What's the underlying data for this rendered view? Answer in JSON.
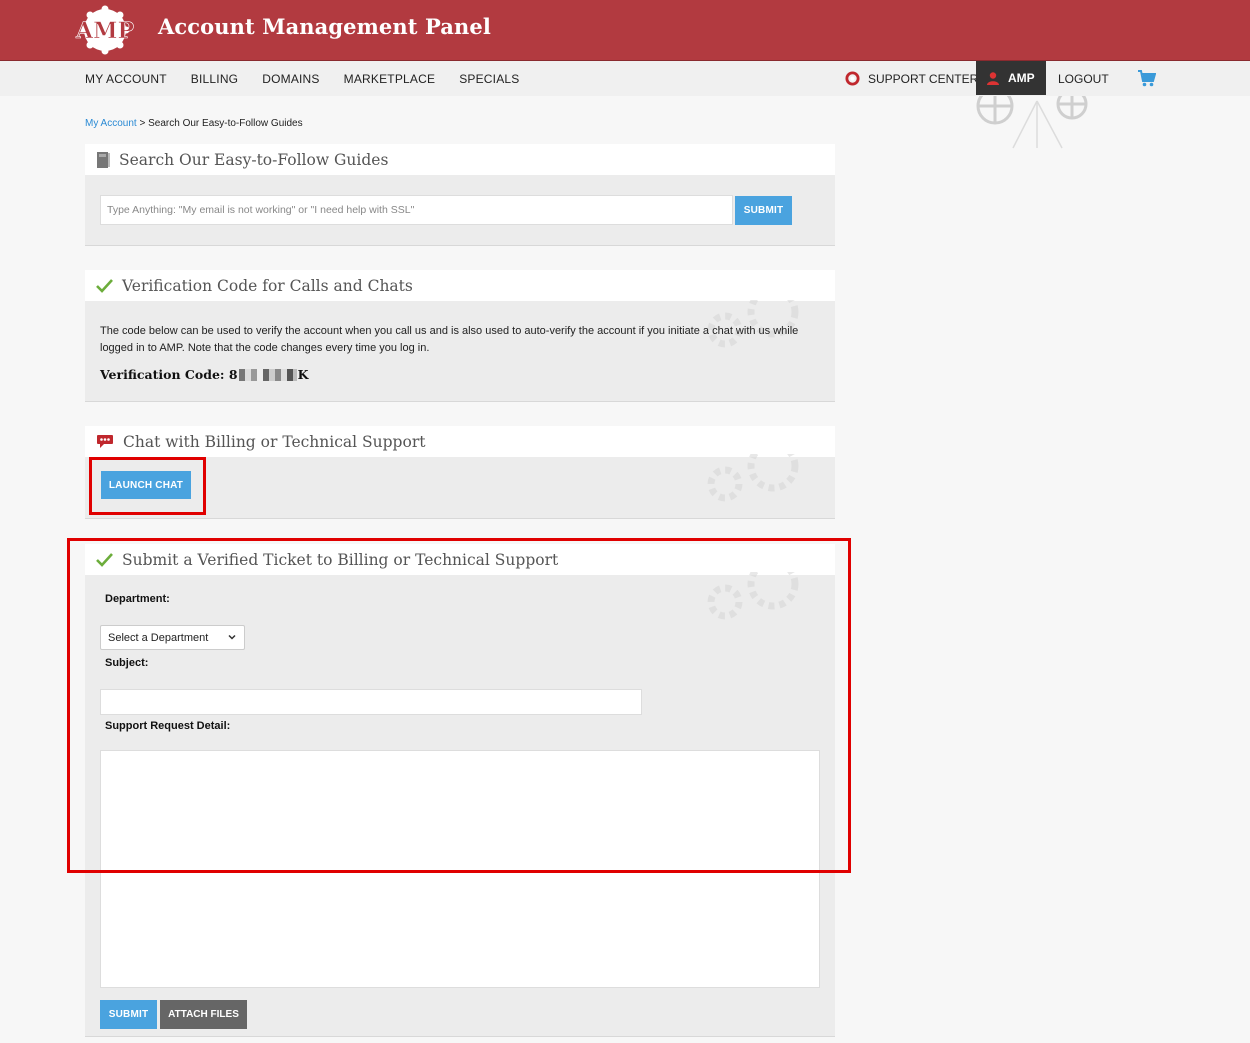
{
  "header": {
    "logo_text": "AMP",
    "title": "Account Management Panel"
  },
  "nav": {
    "items": [
      "MY ACCOUNT",
      "BILLING",
      "DOMAINS",
      "MARKETPLACE",
      "SPECIALS"
    ],
    "support_center": "SUPPORT CENTER",
    "user": "AMP",
    "logout": "LOGOUT"
  },
  "breadcrumb": {
    "link": "My Account",
    "separator": " > ",
    "current": "Search Our Easy-to-Follow Guides"
  },
  "search_panel": {
    "title": "Search Our Easy-to-Follow Guides",
    "placeholder": "Type Anything: \"My email is not working\" or \"I need help with SSL\"",
    "submit_label": "SUBMIT"
  },
  "verification_panel": {
    "title": "Verification Code for Calls and Chats",
    "description": "The code below can be used to verify the account when you call us and is also used to auto-verify the account if you initiate a chat with us while logged in to AMP. Note that the code changes every time you log in.",
    "code_label": "Verification Code:",
    "code_prefix": "8",
    "code_suffix": "K"
  },
  "chat_panel": {
    "title": "Chat with Billing or Technical Support",
    "launch_label": "LAUNCH CHAT"
  },
  "ticket_panel": {
    "title": "Submit a Verified Ticket to Billing or Technical Support",
    "department_label": "Department:",
    "department_selected": "Select a Department",
    "subject_label": "Subject:",
    "subject_value": "",
    "detail_label": "Support Request Detail:",
    "detail_value": "",
    "submit_label": "SUBMIT",
    "attach_label": "ATTACH FILES"
  },
  "colors": {
    "header_red": "#b23a40",
    "button_blue": "#4aa3df",
    "link_blue": "#2a8ad4",
    "check_green": "#6cad3b",
    "highlight_red": "#e00000"
  },
  "icons": [
    "amp-logo",
    "lifebuoy-icon",
    "user-icon",
    "cart-icon",
    "book-icon",
    "check-icon",
    "chat-icon",
    "gears-icon",
    "wagon-icon"
  ]
}
